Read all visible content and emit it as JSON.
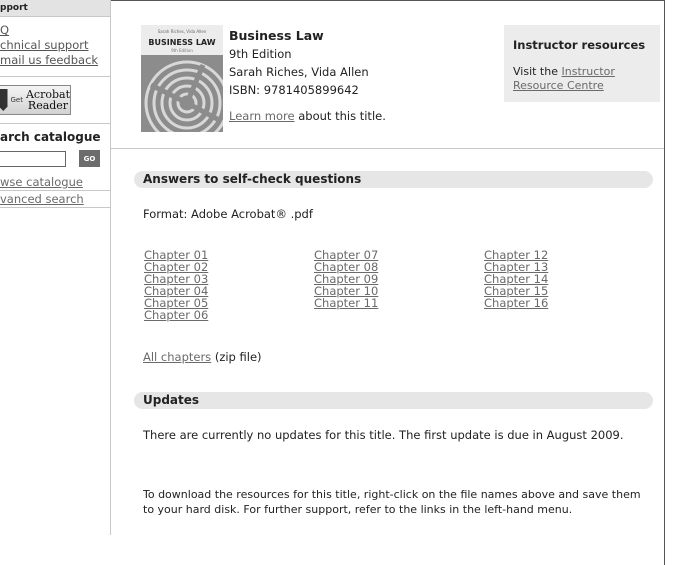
{
  "sidebar": {
    "support_heading": "pport",
    "support_links": [
      "Q",
      "chnical support",
      "mail us feedback"
    ],
    "acrobat": {
      "get": "Get",
      "brand": "Acrobat",
      "product": "Reader"
    },
    "search": {
      "title": "arch catalogue",
      "value": "",
      "go_label": "GO"
    },
    "nav_links": [
      "wse catalogue",
      "vanced search"
    ]
  },
  "book": {
    "cover_authors": "Sarah Riches, Vida Allen",
    "cover_title": "BUSINESS LAW",
    "cover_edition": "9th Edition",
    "title": "Business Law",
    "edition": "9th Edition",
    "authors": "Sarah Riches, Vida Allen",
    "isbn": "ISBN: 9781405899642",
    "learn_more": "Learn more",
    "learn_more_suffix": " about this title."
  },
  "instructor": {
    "title": "Instructor resources",
    "visit_prefix": "Visit the ",
    "link": "Instructor Resource Centre"
  },
  "answers": {
    "heading": "Answers to self-check questions",
    "format": "Format: Adobe Acrobat® .pdf",
    "columns": [
      [
        "Chapter 01",
        "Chapter 02",
        "Chapter 03",
        "Chapter 04",
        "Chapter 05",
        "Chapter 06"
      ],
      [
        "Chapter 07",
        "Chapter 08",
        "Chapter 09",
        "Chapter 10",
        "Chapter 11"
      ],
      [
        "Chapter 12",
        "Chapter 13",
        "Chapter 14",
        "Chapter 15",
        "Chapter 16"
      ]
    ],
    "all_chapters": "All chapters",
    "all_chapters_suffix": " (zip file)"
  },
  "updates": {
    "heading": "Updates",
    "text": "There are currently no updates for this title. The first update is due in August 2009."
  },
  "footer_note": "To download the resources for this title, right-click on the file names above and save them to your hard disk. For further support, refer to the links in the left-hand menu.",
  "colors": {
    "link": "#6a6a6a",
    "bar": "#e6e6e6",
    "panel": "#ececec",
    "go_button": "#6c6c6c"
  }
}
